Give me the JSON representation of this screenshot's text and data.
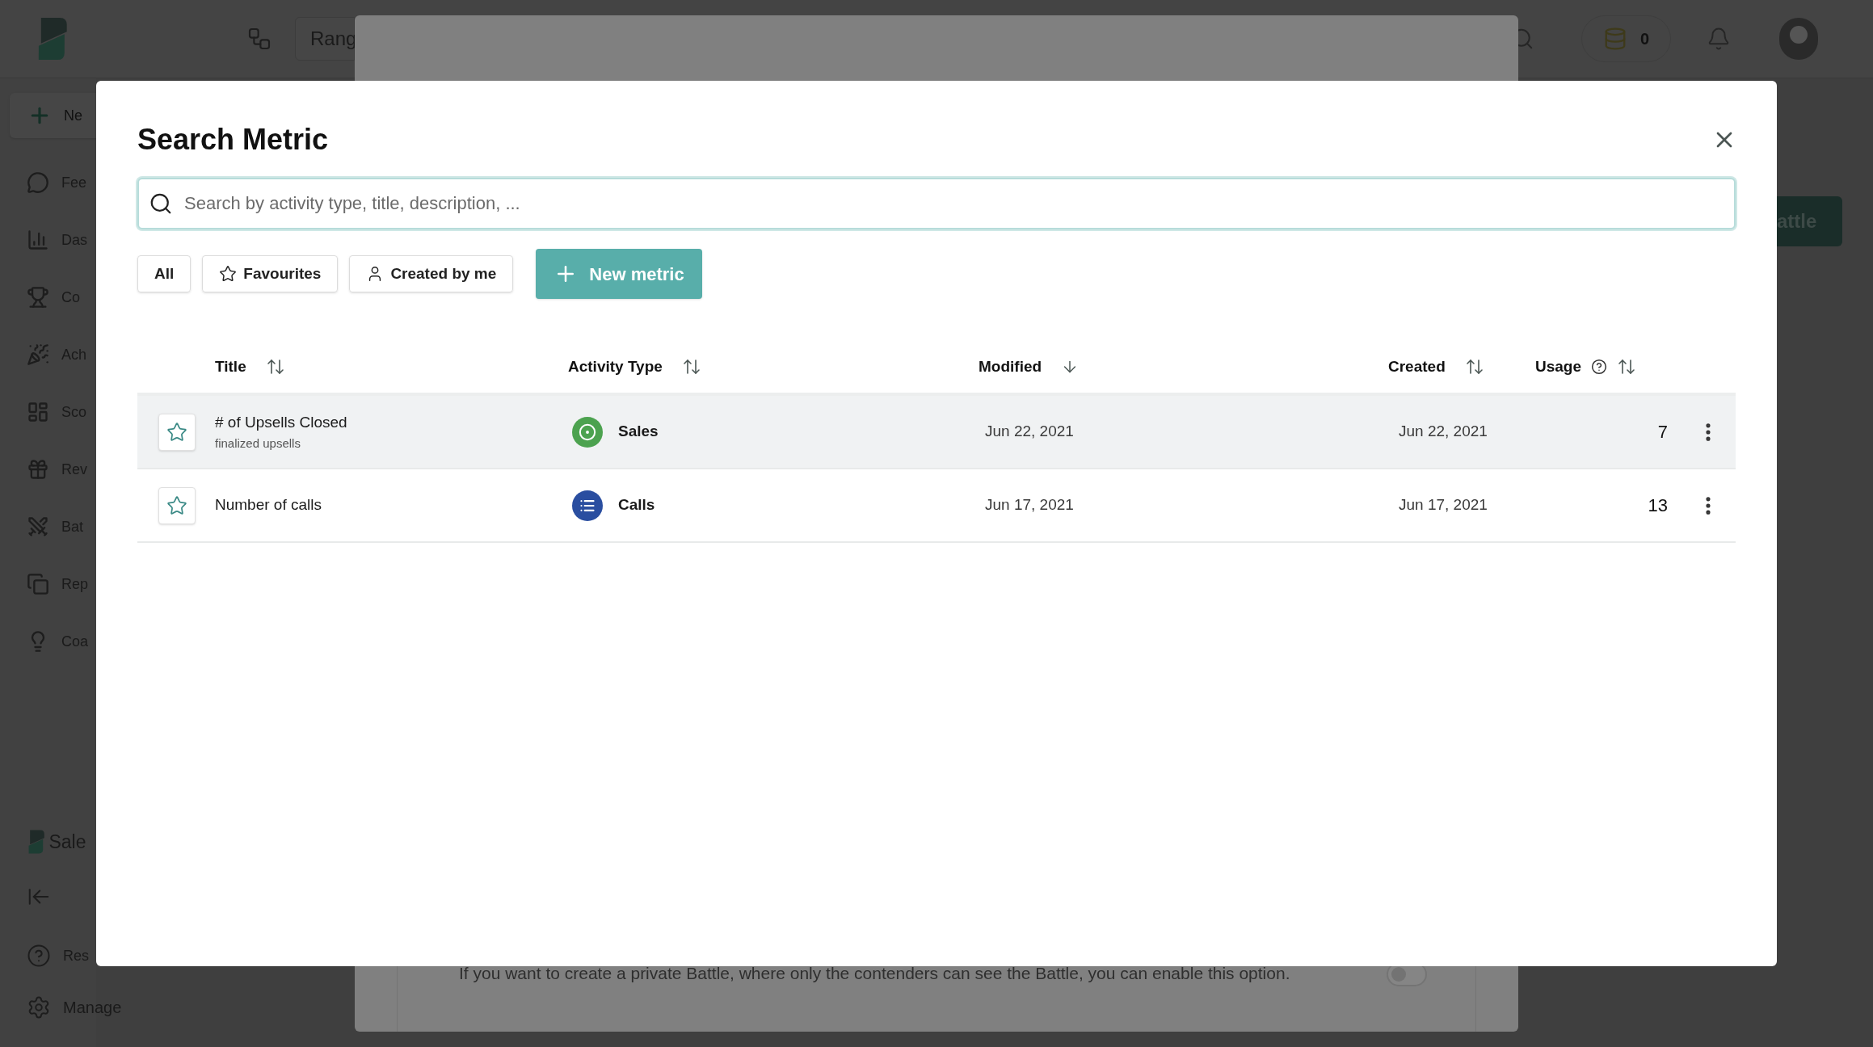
{
  "app": {
    "top_bar": {
      "range_label": "Rang",
      "coin_count": "0"
    },
    "sidebar": {
      "new_item": "Ne",
      "items": [
        "Fee",
        "Das",
        "Co",
        "Ach",
        "Sco",
        "Rev",
        "Bat",
        "Rep",
        "Coa"
      ],
      "brand": "Sale",
      "help_item": "Res",
      "manage_item": "Manage"
    },
    "create_button": "attle"
  },
  "background_dialog": {
    "privacy_note": "If you want to create a private Battle, where only the contenders can see the Battle, you can enable this option.",
    "private_toggle": {
      "on": false
    }
  },
  "dialog": {
    "title": "Search Metric",
    "search": {
      "placeholder": "Search by activity type, title, description, ..."
    },
    "filters": [
      {
        "label": "All",
        "kind": "plain"
      },
      {
        "label": "Favourites",
        "kind": "star"
      },
      {
        "label": "Created by me",
        "kind": "user"
      }
    ],
    "new_button": "New metric",
    "columns": [
      {
        "label": "Title",
        "kind": "sortable",
        "help": false
      },
      {
        "label": "Activity Type",
        "kind": "sortable",
        "help": false
      },
      {
        "label": "Modified",
        "kind": "descending",
        "help": false
      },
      {
        "label": "Created",
        "kind": "sortable",
        "help": false
      },
      {
        "label": "Usage",
        "kind": "sortable",
        "help": true
      }
    ],
    "rows": [
      {
        "title": "# of Upsells Closed",
        "subtitle": "finalized upsells",
        "activity_type": "Sales",
        "kind": "target",
        "color": "#4ca24f",
        "modified": "Jun 22, 2021",
        "created": "Jun 22, 2021",
        "usage": "7",
        "selected": true,
        "favourite": false
      },
      {
        "title": "Number of calls",
        "activity_type": "Calls",
        "kind": "list",
        "color": "#2a4ea0",
        "modified": "Jun 17, 2021",
        "created": "Jun 17, 2021",
        "usage": "13",
        "selected": false,
        "favourite": false
      }
    ]
  }
}
